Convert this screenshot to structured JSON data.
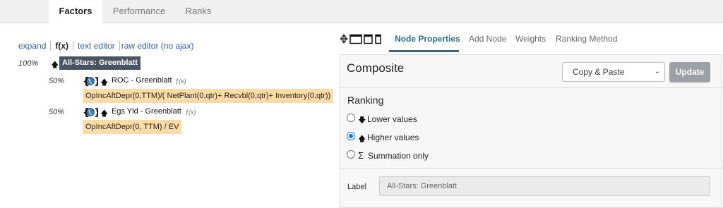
{
  "tabs": [
    {
      "label": "Factors",
      "active": true
    },
    {
      "label": "Performance",
      "active": false
    },
    {
      "label": "Ranks",
      "active": false
    }
  ],
  "toolbar": {
    "expand": "expand",
    "fx": "f(x)",
    "text_editor": "text editor",
    "raw_editor": "raw editor (no ajax)"
  },
  "tree": {
    "root": {
      "weight": "100%",
      "direction": "up",
      "name": "All-Stars: Greenblatt"
    },
    "children": [
      {
        "weight": "50%",
        "direction": "up",
        "name": "ROC - Greenblatt",
        "fx": "ƒ(x)",
        "formula": "OpIncAftDepr(0,TTM)/( NetPlant(0,qtr)+ Recvbl(0,qtr)+ Inventory(0,qtr))"
      },
      {
        "weight": "50%",
        "direction": "up",
        "name": "Egs Yld - Greenblatt",
        "fx": "ƒ(x)",
        "formula": "OpIncAftDepr(0, TTM) / EV"
      }
    ]
  },
  "properties_tabs": [
    "Node Properties",
    "Add Node",
    "Weights",
    "Ranking Method"
  ],
  "properties": {
    "title": "Composite",
    "mode_select": "Copy & Paste",
    "update_label": "Update",
    "ranking_title": "Ranking",
    "ranking_options": [
      {
        "label": "Lower values",
        "checked": false
      },
      {
        "label": "Higher values",
        "checked": true
      },
      {
        "label": "Summation only",
        "checked": false
      }
    ],
    "label_caption": "Label",
    "label_value": "All-Stars: Greenblatt"
  },
  "colors": {
    "accent": "#2a6b8a",
    "root_bg": "#4a5360",
    "formula_bg": "#fbdba6",
    "link": "#2a5db0"
  }
}
